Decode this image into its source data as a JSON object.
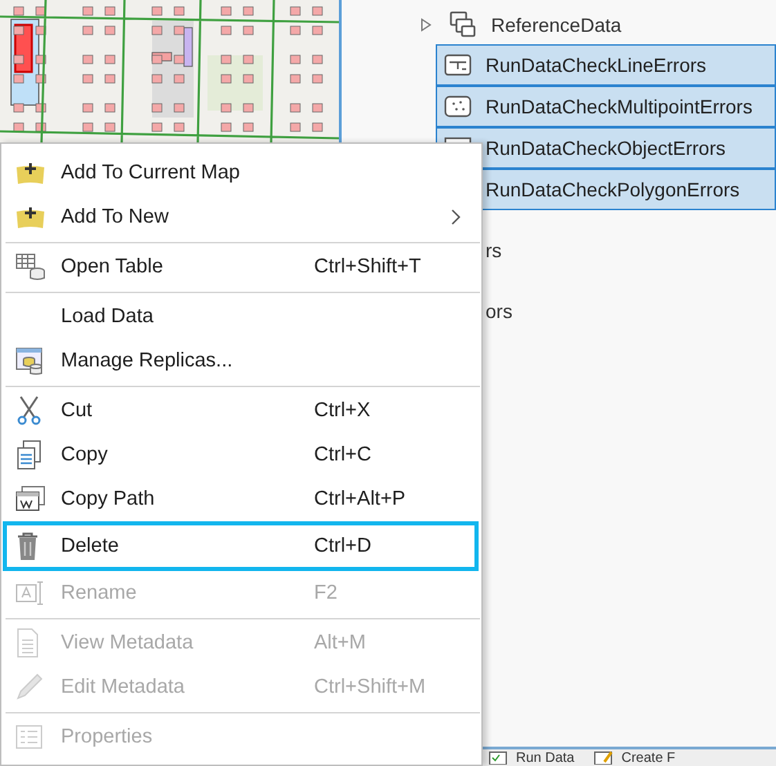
{
  "catalog": {
    "items": [
      {
        "label": "ReferenceData",
        "kind": "group",
        "expanded": false
      },
      {
        "label": "RunDataCheckLineErrors",
        "kind": "line",
        "selected": true
      },
      {
        "label": "RunDataCheckMultipointErrors",
        "kind": "multipoint",
        "selected": true
      },
      {
        "label": "RunDataCheckObjectErrors",
        "kind": "table",
        "selected": true
      },
      {
        "label": "RunDataCheckPolygonErrors",
        "kind": "polygon",
        "selected": true
      },
      {
        "label": "rs",
        "kind": "covered"
      },
      {
        "label": "ors",
        "kind": "covered"
      }
    ]
  },
  "bottom_tabs": [
    {
      "label": "Run Data"
    },
    {
      "label": "Create F"
    }
  ],
  "context_menu": {
    "items": [
      {
        "kind": "item",
        "label": "Add To Current Map",
        "disabled": false,
        "selected": false
      },
      {
        "kind": "item",
        "label": "Add To New",
        "disabled": false,
        "selected": false,
        "submenu": true
      },
      {
        "kind": "separator"
      },
      {
        "kind": "item",
        "label": "Open Table",
        "shortcut": "Ctrl+Shift+T",
        "disabled": false,
        "selected": false
      },
      {
        "kind": "separator"
      },
      {
        "kind": "item",
        "label": "Load Data",
        "disabled": false,
        "selected": false
      },
      {
        "kind": "item",
        "label": "Manage Replicas...",
        "disabled": false,
        "selected": false
      },
      {
        "kind": "separator"
      },
      {
        "kind": "item",
        "label": "Cut",
        "shortcut": "Ctrl+X",
        "disabled": false,
        "selected": false
      },
      {
        "kind": "item",
        "label": "Copy",
        "shortcut": "Ctrl+C",
        "disabled": false,
        "selected": false
      },
      {
        "kind": "item",
        "label": "Copy Path",
        "shortcut": "Ctrl+Alt+P",
        "disabled": false,
        "selected": false
      },
      {
        "kind": "item",
        "label": "Delete",
        "shortcut": "Ctrl+D",
        "disabled": false,
        "selected": true
      },
      {
        "kind": "item",
        "label": "Rename",
        "shortcut": "F2",
        "disabled": true,
        "selected": false
      },
      {
        "kind": "separator"
      },
      {
        "kind": "item",
        "label": "View Metadata",
        "shortcut": "Alt+M",
        "disabled": true,
        "selected": false
      },
      {
        "kind": "item",
        "label": "Edit Metadata",
        "shortcut": "Ctrl+Shift+M",
        "disabled": true,
        "selected": false
      },
      {
        "kind": "separator"
      },
      {
        "kind": "item",
        "label": "Properties",
        "disabled": true,
        "selected": false
      }
    ]
  }
}
